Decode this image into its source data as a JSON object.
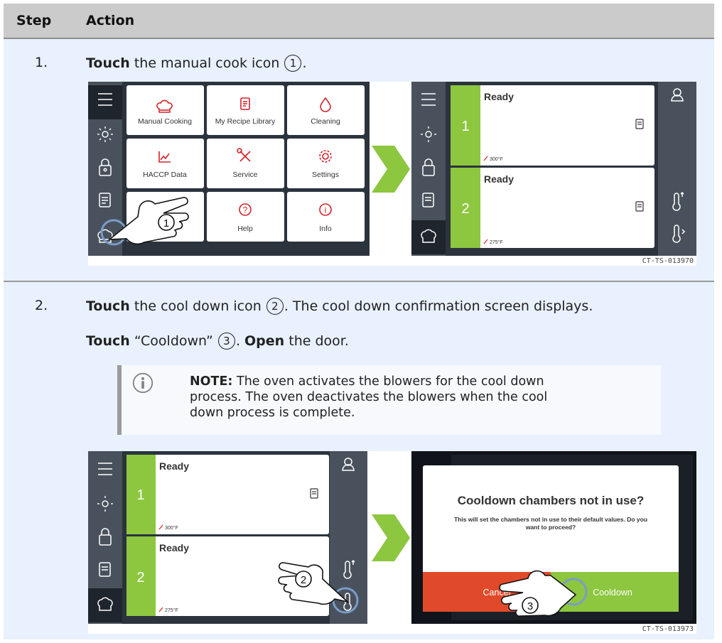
{
  "table": {
    "header": {
      "step": "Step",
      "action": "Action"
    },
    "steps": [
      {
        "number": "1.",
        "lines": [
          {
            "verb": "Touch",
            "text_a": "the manual cook icon",
            "callout": "1",
            "text_b": "."
          }
        ],
        "figure": {
          "caption": "CT-TS-013970",
          "menu": {
            "tiles": [
              "Manual Cooking",
              "My Recipe Library",
              "Cleaning",
              "HACCP Data",
              "Service",
              "Settings",
              "",
              "Help",
              "Info"
            ],
            "callout": "1"
          },
          "status": {
            "chambers": [
              {
                "number": "1",
                "state": "Ready",
                "temp": "300°F"
              },
              {
                "number": "2",
                "state": "Ready",
                "temp": "275°F"
              }
            ]
          }
        }
      },
      {
        "number": "2.",
        "lines": [
          {
            "verb": "Touch",
            "text_a": "the cool down icon",
            "callout": "2",
            "text_b": ". The cool down confirmation screen displays."
          },
          {
            "verb": "Touch",
            "text_a": "“Cooldown”",
            "callout": "3",
            "text_b": ".",
            "verb2": "Open",
            "text_c": "the door."
          }
        ],
        "note": {
          "label": "NOTE:",
          "lines": [
            "The oven activates the blowers for the cool down",
            "process. The oven deactivates the blowers when the cool",
            "down process is complete."
          ]
        },
        "figure": {
          "caption": "CT-TS-013973",
          "status": {
            "chambers": [
              {
                "number": "1",
                "state": "Ready",
                "temp": "300°F"
              },
              {
                "number": "2",
                "state": "Ready",
                "temp": "275°F"
              }
            ],
            "callout": "2"
          },
          "dialog": {
            "title": "Cooldown chambers not in use?",
            "message_line1": "This will set the chambers not in use to their default values. Do you",
            "message_line2": "want to proceed?",
            "cancel": "Cancel",
            "confirm": "Cooldown",
            "callout": "3"
          }
        }
      }
    ]
  },
  "colors": {
    "accent_green": "#8dc63f",
    "alert_red": "#e04a2a",
    "panel_dark": "#2b333d",
    "sidebar": "#49525c",
    "row_bg": "#e8f1fd"
  }
}
